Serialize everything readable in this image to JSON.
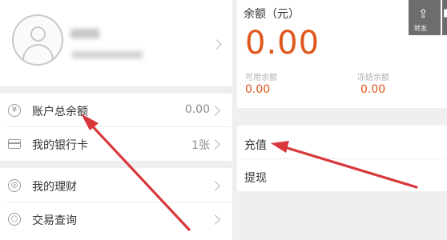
{
  "account": {
    "rows": [
      {
        "label": "账户总余额",
        "value": "0.00",
        "icon": "yen-icon"
      },
      {
        "label": "我的银行卡",
        "value": "1张",
        "icon": "bank-card-icon"
      },
      {
        "label": "我的理财",
        "value": "",
        "icon": "wealth-icon"
      },
      {
        "label": "交易查询",
        "value": "",
        "icon": "search-icon"
      }
    ]
  },
  "balance": {
    "title": "余额（元）",
    "amount": "0.00",
    "available_label": "可用余额",
    "available_value": "0.00",
    "frozen_label": "冻结余额",
    "frozen_value": "0.00"
  },
  "actions": {
    "recharge": "充值",
    "withdraw": "提现"
  },
  "toolbar": {
    "share_label": "转发"
  },
  "colors": {
    "accent": "#e0571b",
    "arrow": "#d8383b"
  }
}
